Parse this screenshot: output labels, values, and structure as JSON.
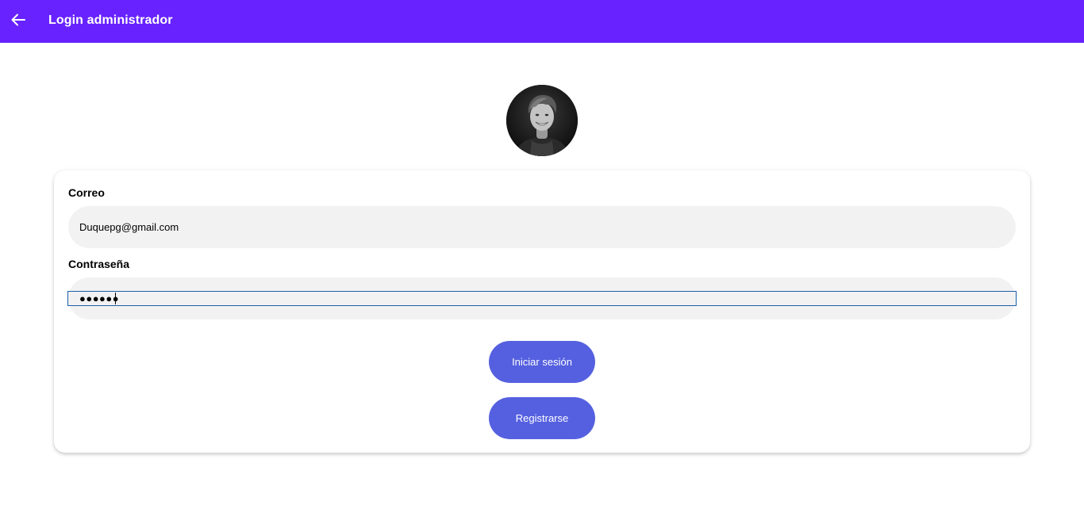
{
  "header": {
    "title": "Login administrador",
    "back_icon": "arrow-left-icon",
    "color": "#6722ff"
  },
  "avatar": {
    "icon": "user-photo"
  },
  "form": {
    "email_label": "Correo",
    "email_value": "Duquepg@gmail.com",
    "password_label": "Contraseña",
    "password_value": "●●●●●●"
  },
  "buttons": {
    "login": "Iniciar sesión",
    "register": "Registrarse",
    "color": "#5560e0"
  }
}
